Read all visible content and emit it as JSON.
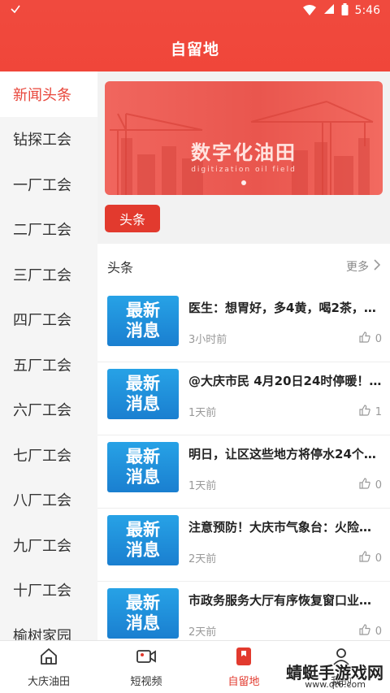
{
  "status": {
    "left_icon": "check-icon",
    "time": "5:46"
  },
  "header": {
    "title": "自留地"
  },
  "sidebar": {
    "items": [
      {
        "label": "新闻头条",
        "active": true
      },
      {
        "label": "钻探工会"
      },
      {
        "label": "一厂工会"
      },
      {
        "label": "二厂工会"
      },
      {
        "label": "三厂工会"
      },
      {
        "label": "四厂工会"
      },
      {
        "label": "五厂工会"
      },
      {
        "label": "六厂工会"
      },
      {
        "label": "七厂工会"
      },
      {
        "label": "八厂工会"
      },
      {
        "label": "九厂工会"
      },
      {
        "label": "十厂工会"
      },
      {
        "label": "榆树家园"
      }
    ]
  },
  "banner": {
    "title": "数字化油田",
    "subtitle": "digitization oil field"
  },
  "tag": {
    "label": "头条"
  },
  "panel": {
    "title": "头条",
    "more": "更多",
    "news": [
      {
        "thumb_top": "最新",
        "thumb_bottom": "消息",
        "title": "医生：想胃好，多4黄，喝2茶，…",
        "time": "3小时前",
        "likes": "0"
      },
      {
        "thumb_top": "最新",
        "thumb_bottom": "消息",
        "title": "@大庆市民 4月20日24时停暖！…",
        "time": "1天前",
        "likes": "1"
      },
      {
        "thumb_top": "最新",
        "thumb_bottom": "消息",
        "title": "明日，让区这些地方将停水24个…",
        "time": "1天前",
        "likes": "0"
      },
      {
        "thumb_top": "最新",
        "thumb_bottom": "消息",
        "title": "注意预防！大庆市气象台：火险…",
        "time": "2天前",
        "likes": "0"
      },
      {
        "thumb_top": "最新",
        "thumb_bottom": "消息",
        "title": "市政务服务大厅有序恢复窗口业…",
        "time": "2天前",
        "likes": "0"
      }
    ]
  },
  "bottomnav": {
    "items": [
      {
        "label": "大庆油田",
        "icon": "home-icon"
      },
      {
        "label": "短视频",
        "icon": "video-icon"
      },
      {
        "label": "自留地",
        "icon": "bookmark-icon",
        "active": true
      },
      {
        "label": "我的",
        "icon": "user-icon"
      }
    ]
  },
  "watermark": {
    "text": "蜻蜓手游戏网",
    "url": "www.qt6.com"
  },
  "colors": {
    "accent": "#e23a2e",
    "header": "#f04a3e",
    "thumb": "#1a7fd0"
  }
}
